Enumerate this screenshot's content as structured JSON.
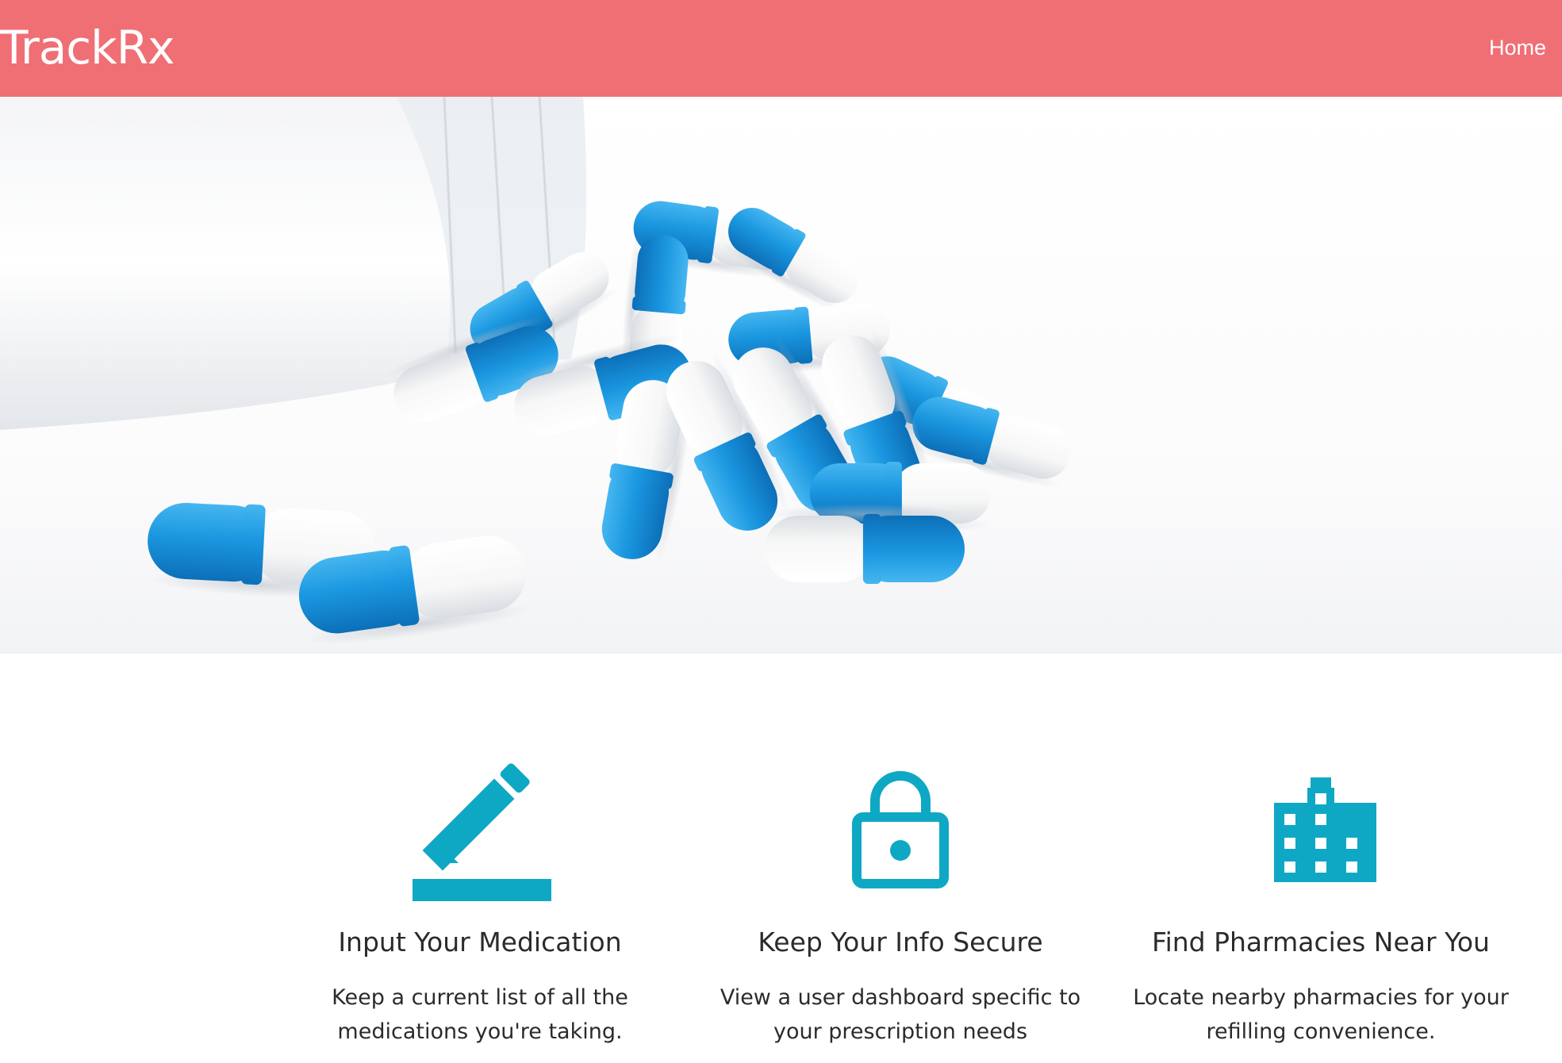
{
  "navbar": {
    "brand": "TrackRx",
    "home_label": "Home",
    "background_color": "#ef6f75"
  },
  "hero": {
    "image": "capsules-spilling-from-bottle",
    "capsule_color": "#1d9ae0"
  },
  "features": [
    {
      "icon": "pencil-edit-icon",
      "title": "Input Your Medication",
      "description": "Keep a current list of all the medications you're taking."
    },
    {
      "icon": "lock-icon",
      "title": "Keep Your Info Secure",
      "description": "View a user dashboard specific to your prescription needs"
    },
    {
      "icon": "building-icon",
      "title": "Find Pharmacies Near You",
      "description": "Locate nearby pharmacies for your refilling convenience."
    }
  ],
  "icon_color": "#0fa8c4"
}
